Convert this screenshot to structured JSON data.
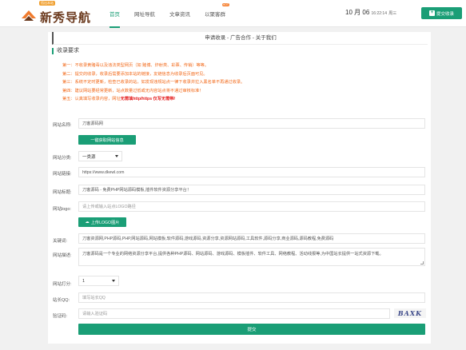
{
  "logo": {
    "badge": "悟出本站",
    "text": "新秀导航"
  },
  "nav": [
    {
      "label": "首页",
      "active": true
    },
    {
      "label": "网址导航"
    },
    {
      "label": "文章资讯"
    },
    {
      "label": "以聚客群",
      "hot": "HOT"
    }
  ],
  "header": {
    "month": "10",
    "month_unit": "月",
    "day": "06",
    "time": "16:22:14",
    "weekday": "周三",
    "submit_label": "提交收录"
  },
  "page_title": "申请收录 - 广告合作 - 关于我们",
  "section_title": "收录要求",
  "rules": [
    "第一：不收录黄赌毒以及违法类型网页（如 赌博、炸射类、彩票、传销）等等。",
    "第二：提交的收录，收录后需要添加本站的链接，友链信息为收录后页面可见。",
    "第三：系统不定时更新，检查已收录的站，如发现违规站点一律下收录并拉入黑名单不再通过收录。",
    "第四：建议网站要经常更新，站点数量过低或无内容站点将不通过审核标准！",
    "第五：认真填写收录内容，网址"
  ],
  "rule5_highlight": "无需填http/https 仅写无需带/",
  "form": {
    "name_label": "网站名称:",
    "name_value": "刀客源码网",
    "fetch_button": "一键获取网站信息",
    "category_label": "网站分类:",
    "category_value": "一类源",
    "url_label": "网站链接:",
    "url_value": "https://www.dkewl.com",
    "title_label": "网站标题:",
    "title_value": "刀客源码 - 免费PHP网站源码模板,插件软件资源分享平台！",
    "logo_label": "网站logo:",
    "logo_placeholder": "请上传或输入站点LOGO路径",
    "upload_button": "上传LOGO图片",
    "keywords_label": "关键词:",
    "keywords_value": "刀客资源网,PHP源码,PHP,网站源码,网站模板,软件源码,游戏源码,资源分享,资源网站源码,工具软件,源码分享,商业源码,源码教程,免费源码",
    "desc_label": "网站描述:",
    "desc_value": "刀客源码是一个专业的网络资源分享平台,提供各种PHP源码、网站源码、游戏源码、模板插件、软件工具、网络教程、活动线报等,为中国站长提供一站式资源下载。",
    "rating_label": "网站打分:",
    "rating_value": "1",
    "qq_label": "站长QQ:",
    "qq_placeholder": "填写站长QQ",
    "captcha_label": "验证码:",
    "captcha_placeholder": "请输入验证码",
    "captcha_text": "BAXK",
    "submit_label": "提交"
  }
}
